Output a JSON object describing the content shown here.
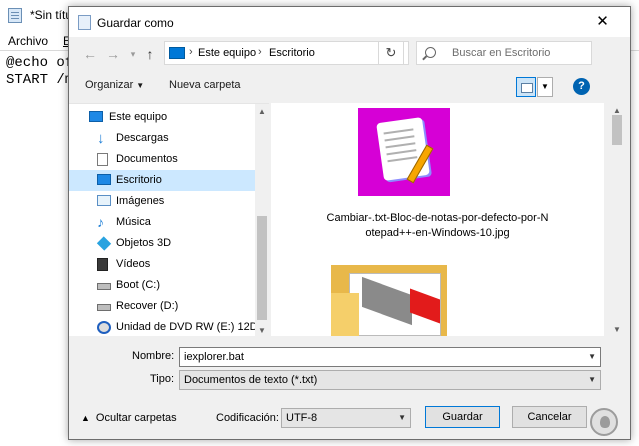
{
  "notepad": {
    "title": "*Sin títu",
    "menu": [
      "Archivo",
      "E"
    ],
    "lines": [
      "@echo of",
      "START /m"
    ]
  },
  "dialog": {
    "title": "Guardar como",
    "address": {
      "crumbs": [
        "Este equipo",
        "Escritorio"
      ]
    },
    "search_placeholder": "Buscar en Escritorio",
    "toolbar": {
      "organize": "Organizar",
      "new_folder": "Nueva carpeta",
      "help": "?"
    },
    "nav_items": [
      {
        "label": "Este equipo",
        "icon": "pc-icon"
      },
      {
        "label": "Descargas",
        "icon": "download-icon"
      },
      {
        "label": "Documentos",
        "icon": "documents-icon"
      },
      {
        "label": "Escritorio",
        "icon": "desktop-icon",
        "selected": true
      },
      {
        "label": "Imágenes",
        "icon": "pictures-icon"
      },
      {
        "label": "Música",
        "icon": "music-icon"
      },
      {
        "label": "Objetos 3D",
        "icon": "3d-objects-icon"
      },
      {
        "label": "Vídeos",
        "icon": "videos-icon"
      },
      {
        "label": "Boot (C:)",
        "icon": "drive-icon"
      },
      {
        "label": "Recover (D:)",
        "icon": "drive-icon"
      },
      {
        "label": "Unidad de DVD RW (E:) 12DC1-",
        "icon": "dvd-drive-icon"
      }
    ],
    "files": [
      {
        "name": "Cambiar-.txt-Bloc-de-notas-por-defecto-por-Notepad++-en-Windows-10.jpg",
        "line1": "Cambiar-.txt-Bloc-de-notas-por-defecto-por-N",
        "line2": "otepad++-en-Windows-10.jpg"
      }
    ],
    "form": {
      "filename_label": "Nombre:",
      "filename_value": "iexplorer.bat",
      "type_label": "Tipo:",
      "type_value": "Documentos de texto (*.txt)",
      "encoding_label": "Codificación:",
      "encoding_value": "UTF-8",
      "save_button": "Guardar",
      "cancel_button": "Cancelar",
      "hide_folders": "Ocultar carpetas"
    }
  },
  "colors": {
    "accent": "#0078d7",
    "selection": "#cce8ff",
    "thumb_bg": "#d600d6"
  }
}
